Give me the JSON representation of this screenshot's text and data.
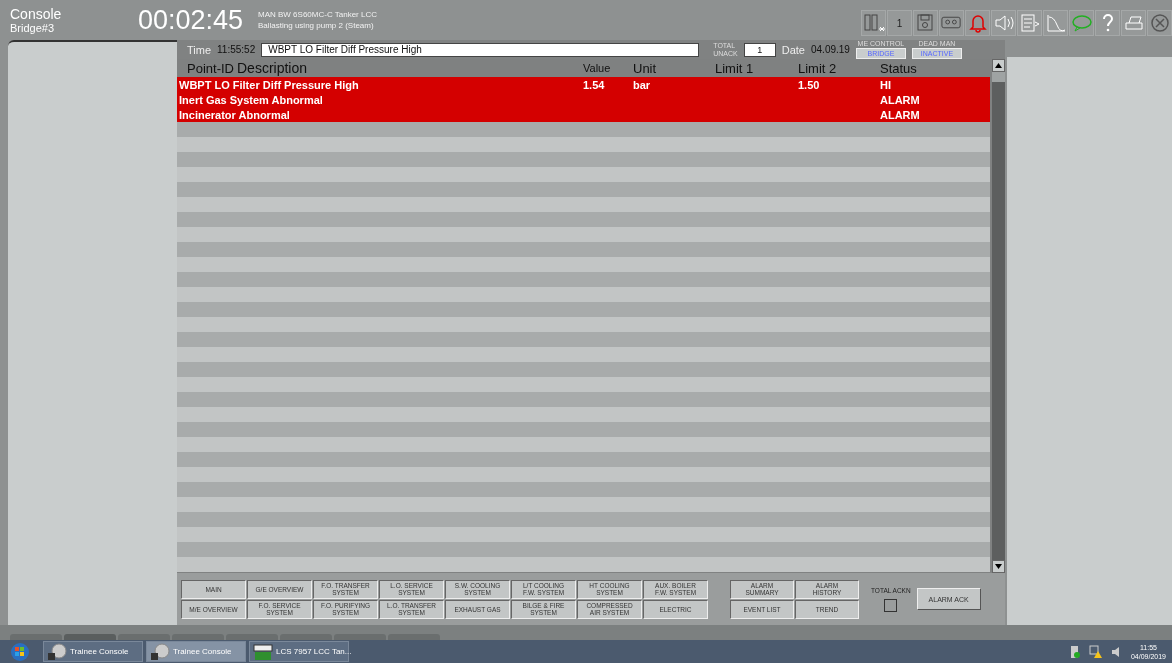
{
  "header": {
    "console_label": "Console",
    "station": "Bridge#3",
    "elapsed": "00:02:45",
    "model": "MAN BW 6S60MC-C Tanker LCC",
    "scenario": "Ballasting using pump 2 (Steam)",
    "display_number": "1"
  },
  "alarm_bar": {
    "time_label": "Time",
    "time": "11:55:52",
    "message": "WBPT LO Filter Diff Pressure High",
    "unack_label_1": "TOTAL",
    "unack_label_2": "UNACK",
    "unack": "1",
    "date_label": "Date",
    "date": "04.09.19",
    "me_control_label": "ME CONTROL",
    "me_control": "BRIDGE",
    "dead_man_label": "DEAD MAN",
    "dead_man": "INACTIVE"
  },
  "table": {
    "columns": [
      "Point-ID",
      "Description",
      "Value",
      "Unit",
      "Limit 1",
      "Limit 2",
      "Status"
    ],
    "rows": [
      {
        "description": "WBPT LO Filter Diff Pressure High",
        "value": "1.54",
        "unit": "bar",
        "limit_1": "",
        "limit_2": "1.50",
        "status": "HI",
        "active": true
      },
      {
        "description": "Inert Gas System Abnormal",
        "value": "",
        "unit": "",
        "limit_1": "",
        "limit_2": "",
        "status": "ALARM",
        "active": true
      },
      {
        "description": "Incinerator Abnormal",
        "value": "",
        "unit": "",
        "limit_1": "",
        "limit_2": "",
        "status": "ALARM",
        "active": true
      }
    ]
  },
  "nav_buttons": [
    [
      {
        "line_1": "MAIN"
      },
      {
        "line_1": "G/E OVERVIEW"
      },
      {
        "line_1": "F.O. TRANSFER",
        "line_2": "SYSTEM"
      },
      {
        "line_1": "L.O. SERVICE",
        "line_2": "SYSTEM"
      },
      {
        "line_1": "S.W. COOLING",
        "line_2": "SYSTEM"
      },
      {
        "line_1": "L/T COOLING",
        "line_2": "F.W. SYSTEM"
      },
      {
        "line_1": "HT COOLING",
        "line_2": "SYSTEM"
      },
      {
        "line_1": "AUX. BOILER",
        "line_2": "F.W. SYSTEM"
      }
    ],
    [
      {
        "line_1": "M/E OVERVIEW"
      },
      {
        "line_1": "F.O. SERVICE",
        "line_2": "SYSTEM"
      },
      {
        "line_1": "F.O. PURIFYING",
        "line_2": "SYSTEM"
      },
      {
        "line_1": "L.O. TRANSFER",
        "line_2": "SYSTEM"
      },
      {
        "line_1": "EXHAUST GAS"
      },
      {
        "line_1": "BILGE & FIRE",
        "line_2": "SYSTEM"
      },
      {
        "line_1": "COMPRESSED",
        "line_2": "AIR SYSTEM"
      },
      {
        "line_1": "ELECTRIC"
      }
    ]
  ],
  "alarm_buttons": [
    [
      {
        "line_1": "ALARM",
        "line_2": "SUMMARY"
      },
      {
        "line_1": "ALARM",
        "line_2": "HISTORY"
      }
    ],
    [
      {
        "line_1": "EVENT LIST"
      },
      {
        "line_1": "TREND"
      }
    ]
  ],
  "total_ackn": {
    "label": "TOTAL ACKN",
    "checked": false
  },
  "alarm_ack": "ALARM ACK",
  "taskbar": {
    "items": [
      {
        "label": "Trainee Console",
        "selected": false
      },
      {
        "label": "Trainee Console",
        "selected": true
      },
      {
        "label": "LCS 7957 LCC Tan...",
        "selected": false
      }
    ],
    "clock_time": "11:55",
    "clock_date": "04/09/2019"
  }
}
